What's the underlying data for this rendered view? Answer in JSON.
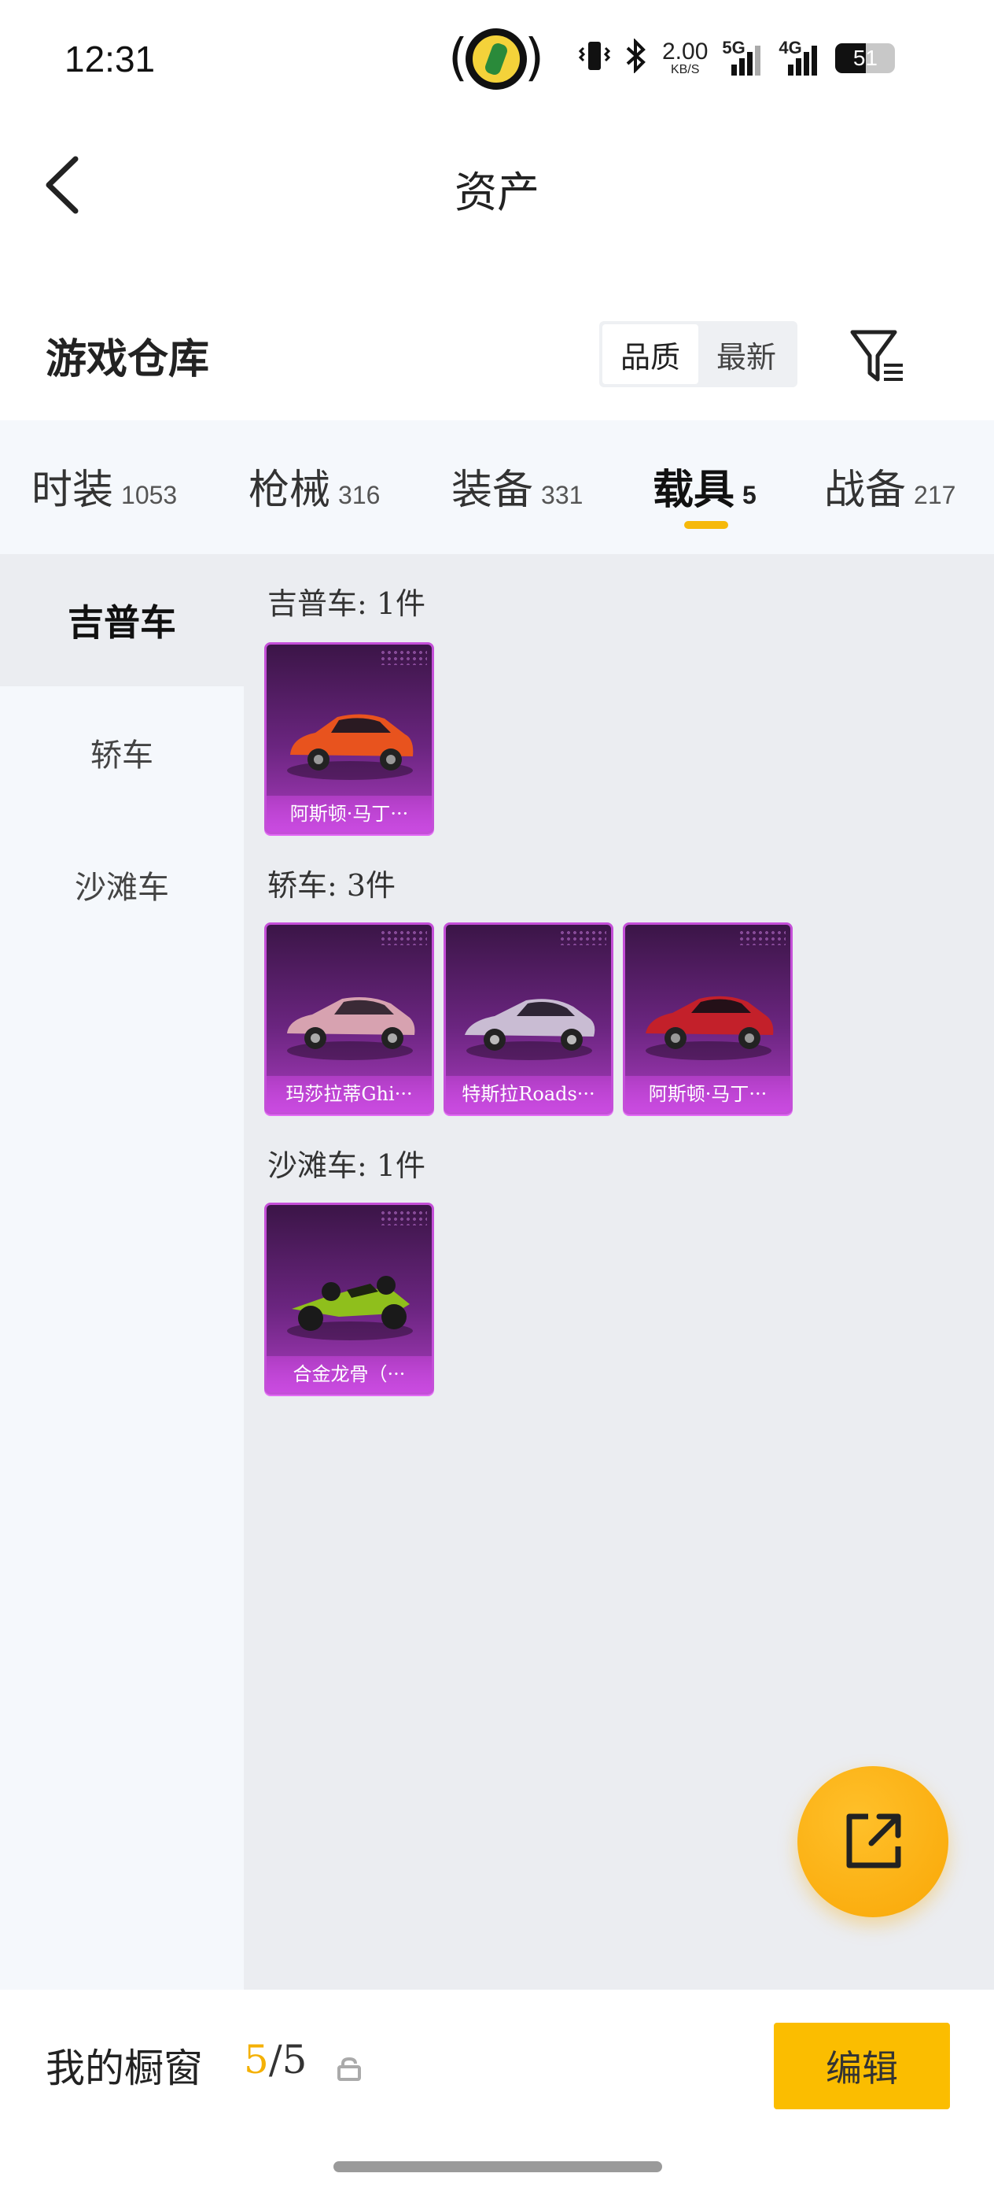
{
  "status_bar": {
    "time": "12:31",
    "speed_value": "2.00",
    "speed_unit": "KB/S",
    "net1": "5G",
    "net2": "4G",
    "battery": "51",
    "battery_level": 0.51,
    "icons": [
      "app-notification-icon",
      "vibrate-icon",
      "bluetooth-icon",
      "signal-5g-icon",
      "signal-4g-icon",
      "battery-icon"
    ]
  },
  "header": {
    "title": "资产",
    "back_icon": "chevron-left-icon"
  },
  "warehouse": {
    "title": "游戏仓库",
    "sort_options": [
      "品质",
      "最新"
    ],
    "active_sort": 0,
    "filter_icon": "filter-icon"
  },
  "tabs": [
    {
      "label": "时装",
      "count": "1053"
    },
    {
      "label": "枪械",
      "count": "316"
    },
    {
      "label": "装备",
      "count": "331"
    },
    {
      "label": "载具",
      "count": "5"
    },
    {
      "label": "战备",
      "count": "217"
    }
  ],
  "active_tab": 3,
  "subnav": [
    "吉普车",
    "轿车",
    "沙滩车"
  ],
  "active_subnav": 0,
  "groups": [
    {
      "title": "吉普车: 1件",
      "items": [
        {
          "name": "阿斯顿·马丁···",
          "color": "#e8531e"
        }
      ]
    },
    {
      "title": "轿车: 3件",
      "items": [
        {
          "name": "玛莎拉蒂Ghi···",
          "color": "#d7a2b0"
        },
        {
          "name": "特斯拉Roads···",
          "color": "#c9bcd3"
        },
        {
          "name": "阿斯顿·马丁···",
          "color": "#c3202a"
        }
      ]
    },
    {
      "title": "沙滩车: 1件",
      "items": [
        {
          "name": "合金龙骨（···",
          "color": "#8fbf1c"
        }
      ]
    }
  ],
  "share_icon": "share-external-icon",
  "bottom": {
    "showcase_label": "我的橱窗",
    "current": "5",
    "total": "/5",
    "lock_icon": "lock-icon",
    "edit_label": "编辑"
  },
  "colors": {
    "accent": "#f6b90a",
    "card_purple": "#6b2580",
    "card_border": "#c44fd8"
  }
}
